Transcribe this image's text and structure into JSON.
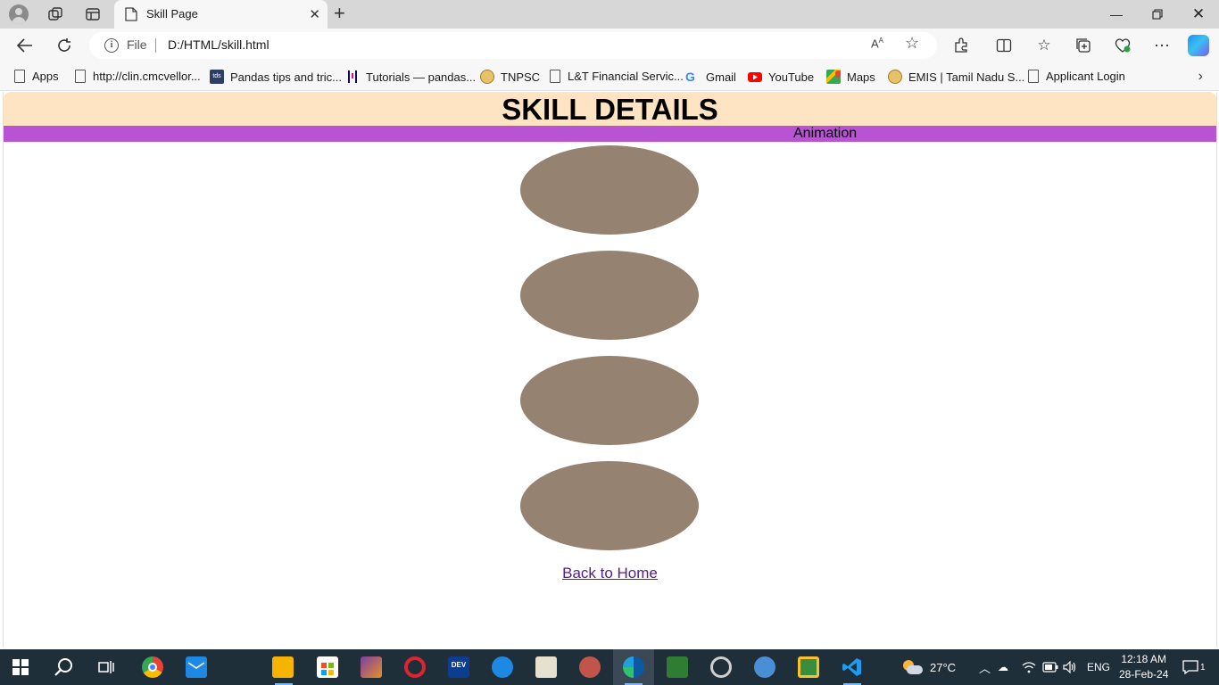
{
  "browser": {
    "tab": {
      "title": "Skill Page"
    },
    "address": {
      "scheme_label": "File",
      "url": "D:/HTML/skill.html"
    },
    "bookmarks": [
      {
        "label": "Apps",
        "icon": "document-icon"
      },
      {
        "label": "http://clin.cmcvellor...",
        "icon": "document-icon"
      },
      {
        "label": "Pandas tips and tric...",
        "icon": "tds-icon"
      },
      {
        "label": "Tutorials — pandas...",
        "icon": "pandas-icon"
      },
      {
        "label": "TNPSC",
        "icon": "emblem-icon"
      },
      {
        "label": "L&T Financial Servic...",
        "icon": "document-icon"
      },
      {
        "label": "Gmail",
        "icon": "google-icon"
      },
      {
        "label": "YouTube",
        "icon": "youtube-icon"
      },
      {
        "label": "Maps",
        "icon": "maps-icon"
      },
      {
        "label": "EMIS | Tamil Nadu S...",
        "icon": "emblem-icon"
      },
      {
        "label": "Applicant Login",
        "icon": "document-icon"
      }
    ]
  },
  "page": {
    "title": "SKILL DETAILS",
    "marquee_text": "Animation",
    "skill_ovals": 4,
    "back_link": "Back to Home",
    "colors": {
      "header_bg": "#ffe4c4",
      "marquee_bg": "#b854d4",
      "oval": "#958270",
      "link": "#551a8b"
    }
  },
  "taskbar": {
    "weather": "27°C",
    "language": "ENG",
    "time": "12:18 AM",
    "date": "28-Feb-24",
    "notifications": "1"
  }
}
